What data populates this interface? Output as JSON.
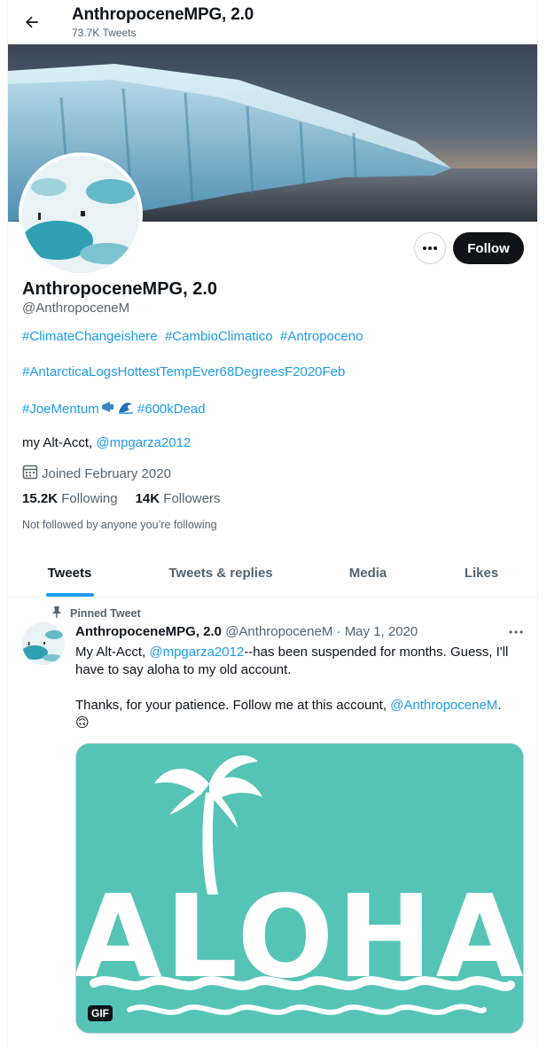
{
  "header": {
    "title": "AnthropoceneMPG, 2.0",
    "tweet_count": "73.7K Tweets"
  },
  "profile": {
    "name": "AnthropoceneMPG, 2.0",
    "handle": "@AnthropoceneM",
    "follow_label": "Follow",
    "bio_hashtags_1": [
      "#ClimateChangeishere",
      "#CambioClimatico",
      "#Antropoceno"
    ],
    "bio_hashtags_2": [
      "#AntarcticaLogsHottestTempEver68DegreesF2020Feb"
    ],
    "bio_hashtag_joe": "#JoeMentum",
    "bio_hashtag_dead": "#600kDead",
    "bio_text_prefix": "my Alt-Acct, ",
    "bio_mention": "@mpgarza2012",
    "joined": "Joined February 2020",
    "following_count": "15.2K",
    "following_label": "Following",
    "followers_count": "14K",
    "followers_label": "Followers",
    "not_followed": "Not followed by anyone you’re following"
  },
  "tabs": [
    {
      "label": "Tweets"
    },
    {
      "label": "Tweets & replies"
    },
    {
      "label": "Media"
    },
    {
      "label": "Likes"
    }
  ],
  "tweet": {
    "pinned_label": "Pinned Tweet",
    "author_name": "AnthropoceneMPG, 2.0",
    "author_handle": "@AnthropoceneM",
    "date": "May 1, 2020",
    "line1_prefix": "My Alt-Acct, ",
    "line1_mention": "@mpgarza2012",
    "line1_suffix": "--has been suspended for months. Guess, I'll have to say aloha to my old account.",
    "line2_prefix": "Thanks, for your patience.  Follow me at this account, ",
    "line2_mention": "@AnthropoceneM",
    "line2_suffix": ".",
    "emoji": "🙃",
    "gif_text": "ALOHA",
    "gif_badge": "GIF"
  },
  "colors": {
    "accent": "#1d9bf0",
    "gif_bg": "#55c4b6"
  }
}
